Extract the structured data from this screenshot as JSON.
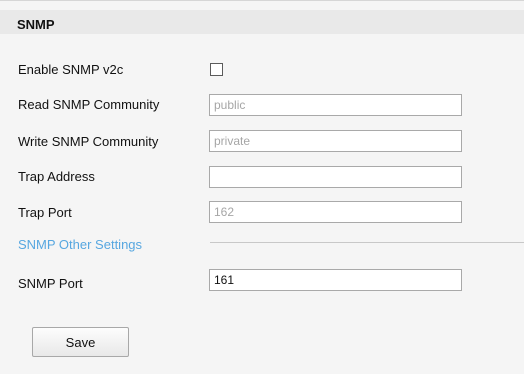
{
  "section": {
    "title": "SNMP"
  },
  "fields": {
    "enable_v2c": {
      "label": "Enable SNMP v2c",
      "checked": false
    },
    "read_community": {
      "label": "Read SNMP Community",
      "value": "public",
      "disabled": true
    },
    "write_community": {
      "label": "Write SNMP Community",
      "value": "private",
      "disabled": true
    },
    "trap_address": {
      "label": "Trap Address",
      "value": ""
    },
    "trap_port": {
      "label": "Trap Port",
      "value": "162",
      "disabled": true
    }
  },
  "other_settings": {
    "title": "SNMP Other Settings",
    "snmp_port": {
      "label": "SNMP Port",
      "value": "161"
    }
  },
  "actions": {
    "save_label": "Save"
  },
  "colors": {
    "section_link": "#57a7e0",
    "header_bg": "#e9e9e9",
    "panel_bg": "#f5f5f5"
  }
}
